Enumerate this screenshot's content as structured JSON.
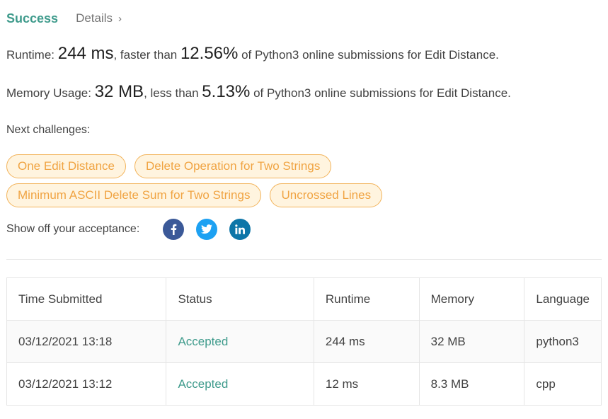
{
  "header": {
    "status": "Success",
    "details": "Details",
    "details_chevron": "›"
  },
  "runtime": {
    "label": "Runtime: ",
    "value": "244 ms",
    "mid": ", faster than ",
    "percent": "12.56%",
    "suffix": " of Python3 online submissions for Edit Distance."
  },
  "memory": {
    "label": "Memory Usage: ",
    "value": "32 MB",
    "mid": ", less than ",
    "percent": "5.13%",
    "suffix": " of Python3 online submissions for Edit Distance."
  },
  "next_challenges": {
    "label": "Next challenges:",
    "items": [
      "One Edit Distance",
      "Delete Operation for Two Strings",
      "Minimum ASCII Delete Sum for Two Strings",
      "Uncrossed Lines"
    ]
  },
  "share": {
    "label": "Show off your acceptance:",
    "icons": [
      "facebook-icon",
      "twitter-icon",
      "linkedin-icon"
    ]
  },
  "colors": {
    "accent": "#3f9b8c",
    "chip_text": "#f0a443",
    "chip_bg": "#fff4df",
    "chip_border": "#f2b35a",
    "facebook": "#3b5998",
    "twitter": "#1da1f2",
    "linkedin": "#0e76a8"
  },
  "table": {
    "headers": [
      "Time Submitted",
      "Status",
      "Runtime",
      "Memory",
      "Language"
    ],
    "rows": [
      [
        "03/12/2021 13:18",
        "Accepted",
        "244 ms",
        "32 MB",
        "python3"
      ],
      [
        "03/12/2021 13:12",
        "Accepted",
        "12 ms",
        "8.3 MB",
        "cpp"
      ]
    ]
  }
}
